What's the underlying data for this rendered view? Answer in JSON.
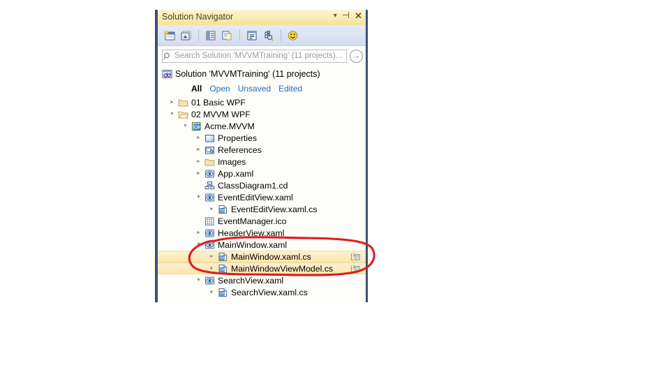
{
  "window": {
    "title": "Solution Navigator",
    "buttons": {
      "dropdown": "▾",
      "pin": "⊣",
      "close": "✕"
    }
  },
  "toolbar": {
    "items": [
      {
        "name": "add-new-item-icon",
        "title": "Add New Item"
      },
      {
        "name": "collapse-all-icon",
        "title": "Collapse All"
      },
      {
        "name": "properties-icon",
        "title": "Properties"
      },
      {
        "name": "new-document-icon",
        "title": "New Document"
      },
      {
        "name": "show-details-icon",
        "title": "Show Details"
      },
      {
        "name": "search-options-icon",
        "title": "Search Options"
      },
      {
        "name": "feedback-smiley-icon",
        "title": "Send Feedback"
      }
    ]
  },
  "search": {
    "placeholder": "Search Solution 'MVVMTraining' (11 projects)...",
    "value": "",
    "go_label": "→"
  },
  "solution": {
    "label": "Solution 'MVVMTraining' (11 projects)",
    "icon": "solution-icon"
  },
  "filters": {
    "items": [
      {
        "label": "All",
        "active": true
      },
      {
        "label": "Open",
        "active": false
      },
      {
        "label": "Unsaved",
        "active": false
      },
      {
        "label": "Edited",
        "active": false
      }
    ]
  },
  "tree": {
    "rows": [
      {
        "label": "01 Basic WPF",
        "indent": 0,
        "expander": "collapsed",
        "icon": "folder-icon",
        "selected": false,
        "end_icon": false
      },
      {
        "label": "02 MVVM WPF",
        "indent": 0,
        "expander": "expanded",
        "icon": "folder-open-icon",
        "selected": false,
        "end_icon": false
      },
      {
        "label": "Acme.MVVM",
        "indent": 1,
        "expander": "expanded",
        "icon": "csharp-project-icon",
        "selected": false,
        "end_icon": false
      },
      {
        "label": "Properties",
        "indent": 2,
        "expander": "collapsed",
        "icon": "properties-icon",
        "selected": false,
        "end_icon": false
      },
      {
        "label": "References",
        "indent": 2,
        "expander": "collapsed",
        "icon": "references-icon",
        "selected": false,
        "end_icon": false
      },
      {
        "label": "Images",
        "indent": 2,
        "expander": "collapsed",
        "icon": "folder-icon",
        "selected": false,
        "end_icon": false
      },
      {
        "label": "App.xaml",
        "indent": 2,
        "expander": "collapsed",
        "icon": "xaml-icon",
        "selected": false,
        "end_icon": false
      },
      {
        "label": "ClassDiagram1.cd",
        "indent": 2,
        "expander": "none",
        "icon": "class-diagram-icon",
        "selected": false,
        "end_icon": false
      },
      {
        "label": "EventEditView.xaml",
        "indent": 2,
        "expander": "expanded",
        "icon": "xaml-icon",
        "selected": false,
        "end_icon": false
      },
      {
        "label": "EventEditView.xaml.cs",
        "indent": 3,
        "expander": "collapsed",
        "icon": "csharp-file-icon",
        "selected": false,
        "end_icon": false
      },
      {
        "label": "EventManager.ico",
        "indent": 2,
        "expander": "none",
        "icon": "ico-file-icon",
        "selected": false,
        "end_icon": false
      },
      {
        "label": "HeaderView.xaml",
        "indent": 2,
        "expander": "collapsed",
        "icon": "xaml-icon",
        "selected": false,
        "end_icon": false
      },
      {
        "label": "MainWindow.xaml",
        "indent": 2,
        "expander": "expanded",
        "icon": "xaml-icon",
        "selected": false,
        "end_icon": false
      },
      {
        "label": "MainWindow.xaml.cs",
        "indent": 3,
        "expander": "collapsed",
        "icon": "csharp-file-icon",
        "selected": true,
        "end_icon": true
      },
      {
        "label": "MainWindowViewModel.cs",
        "indent": 3,
        "expander": "collapsed",
        "icon": "csharp-file-icon",
        "selected": true,
        "end_icon": true
      },
      {
        "label": "SearchView.xaml",
        "indent": 2,
        "expander": "expanded",
        "icon": "xaml-icon",
        "selected": false,
        "end_icon": false
      },
      {
        "label": "SearchView.xaml.cs",
        "indent": 3,
        "expander": "collapsed",
        "icon": "csharp-file-icon",
        "selected": false,
        "end_icon": false
      }
    ]
  },
  "annotation": {
    "shape": "hand-drawn-ellipse",
    "color": "#e01b1b",
    "encircles": [
      "MainWindow.xaml",
      "MainWindow.xaml.cs",
      "MainWindowViewModel.cs"
    ]
  },
  "colors": {
    "titlebar": "#f6eab0",
    "toolbar": "#dce4f2",
    "selection": "#fbe6ae",
    "link": "#1a6fc4",
    "rail": "#3f5170",
    "annotation": "#e01b1b"
  }
}
